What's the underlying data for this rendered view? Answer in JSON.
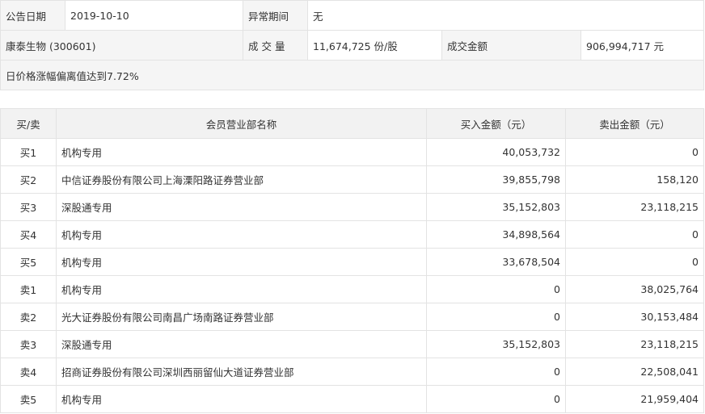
{
  "info": {
    "announce_date_label": "公告日期",
    "announce_date": "2019-10-10",
    "abnormal_period_label": "异常期间",
    "abnormal_period": "无",
    "stock_name": "康泰生物 (300601)",
    "volume_label": "成 交 量",
    "volume": "11,674,725 份/股",
    "turnover_label": "成交金额",
    "turnover": "906,994,717 元",
    "reason": "日价格涨幅偏离值达到7.72%"
  },
  "trades": {
    "headers": [
      "买/卖",
      "会员营业部名称",
      "买入金额（元）",
      "卖出金额（元）"
    ],
    "rows": [
      {
        "side": "买1",
        "name": "机构专用",
        "buy": "40,053,732",
        "sell": "0"
      },
      {
        "side": "买2",
        "name": "中信证券股份有限公司上海溧阳路证券营业部",
        "buy": "39,855,798",
        "sell": "158,120"
      },
      {
        "side": "买3",
        "name": "深股通专用",
        "buy": "35,152,803",
        "sell": "23,118,215"
      },
      {
        "side": "买4",
        "name": "机构专用",
        "buy": "34,898,564",
        "sell": "0"
      },
      {
        "side": "买5",
        "name": "机构专用",
        "buy": "33,678,504",
        "sell": "0"
      },
      {
        "side": "卖1",
        "name": "机构专用",
        "buy": "0",
        "sell": "38,025,764"
      },
      {
        "side": "卖2",
        "name": "光大证券股份有限公司南昌广场南路证券营业部",
        "buy": "0",
        "sell": "30,153,484"
      },
      {
        "side": "卖3",
        "name": "深股通专用",
        "buy": "35,152,803",
        "sell": "23,118,215"
      },
      {
        "side": "卖4",
        "name": "招商证券股份有限公司深圳西丽留仙大道证券营业部",
        "buy": "0",
        "sell": "22,508,041"
      },
      {
        "side": "卖5",
        "name": "机构专用",
        "buy": "0",
        "sell": "21,959,404"
      }
    ]
  }
}
